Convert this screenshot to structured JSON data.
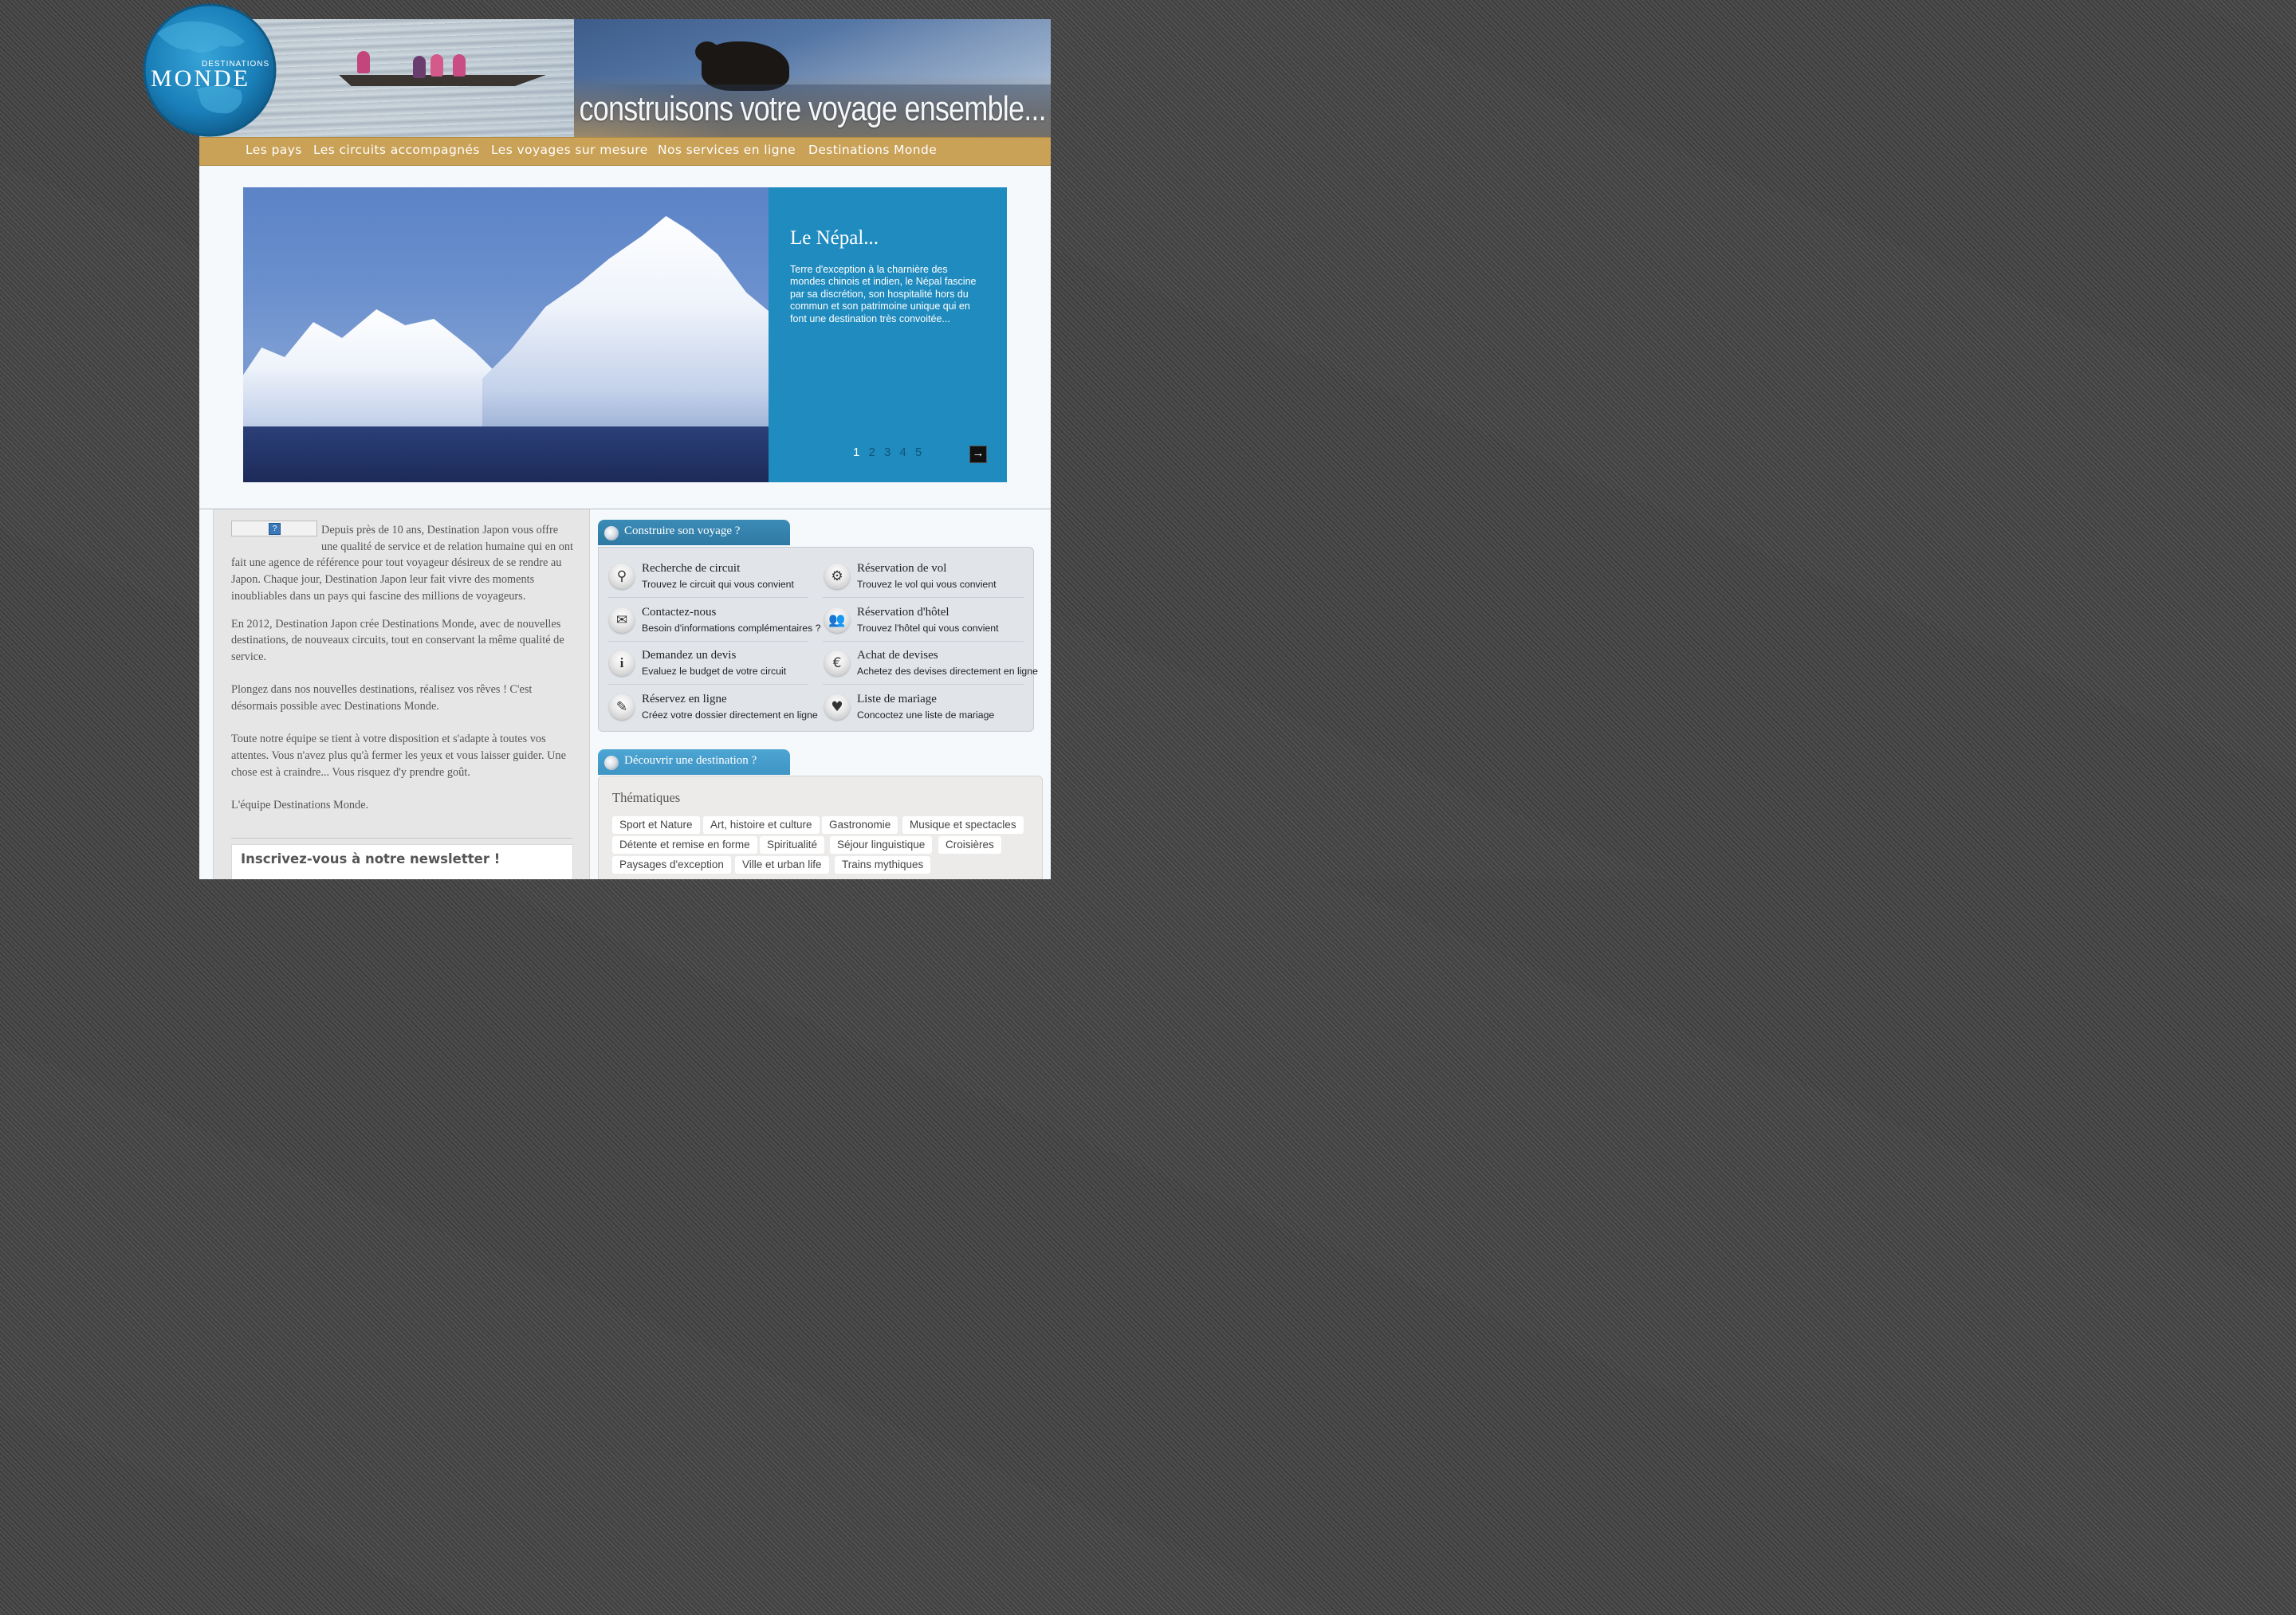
{
  "header": {
    "brand_small": "DESTINATIONS",
    "brand_big": "MONDE",
    "tagline": "construisons votre voyage ensemble..."
  },
  "nav": {
    "items": [
      "Les pays",
      "Les circuits accompagnés",
      "Les voyages sur mesure",
      "Nos services en ligne",
      "Destinations Monde"
    ]
  },
  "slider": {
    "title": "Le Népal...",
    "description": "Terre d'exception à la charnière des mondes chinois et indien, le Népal fascine par sa discrétion, son hospitalité hors du commun et son patrimoine unique qui en font une destination très convoitée...",
    "pages": [
      "1",
      "2",
      "3",
      "4",
      "5"
    ],
    "current_page": "1",
    "next_arrow": "→"
  },
  "intro": {
    "paragraphs": [
      "Depuis près de 10 ans, Destination Japon vous offre une qualité de service et de relation humaine qui en ont fait une agence de référence pour tout voyageur désireux de se rendre au Japon. Chaque jour, Destination Japon leur fait vivre des moments inoubliables dans un pays qui fascine des millions de voyageurs.",
      "En 2012, Destination Japon crée Destinations Monde, avec de nouvelles destinations, de nouveaux circuits, tout en conservant la même qualité de service.",
      "Plongez dans nos nouvelles destinations, réalisez vos rêves ! C'est désormais possible avec Destinations Monde.",
      "Toute notre équipe se tient à votre disposition et s'adapte à toutes vos attentes. Vous n'avez plus qu'à fermer les yeux et vous laisser guider. Une chose est à craindre... Vous risquez d'y prendre goût.",
      "L'équipe Destinations Monde."
    ],
    "broken_image_glyph": "?"
  },
  "newsletter": {
    "title": "Inscrivez-vous à notre newsletter !"
  },
  "construire": {
    "tab_label": "Construire son voyage ?",
    "services": [
      {
        "title": "Recherche de circuit",
        "subtitle": "Trouvez le circuit qui vous convient",
        "icon": "binoculars-icon",
        "glyph": "⚲"
      },
      {
        "title": "Réservation de vol",
        "subtitle": "Trouvez le vol qui vous convient",
        "icon": "gear-icon",
        "glyph": "⚙"
      },
      {
        "title": "Contactez-nous",
        "subtitle": "Besoin d'informations complémentaires ?",
        "icon": "envelope-icon",
        "glyph": "✉"
      },
      {
        "title": "Réservation d'hôtel",
        "subtitle": "Trouvez l'hôtel qui vous convient",
        "icon": "users-icon",
        "glyph": "👥"
      },
      {
        "title": "Demandez un devis",
        "subtitle": "Evaluez le budget de votre circuit",
        "icon": "info-icon",
        "glyph": "i"
      },
      {
        "title": "Achat de devises",
        "subtitle": "Achetez des devises directement en ligne",
        "icon": "euro-icon",
        "glyph": "€"
      },
      {
        "title": "Réservez en ligne",
        "subtitle": "Créez votre dossier directement en ligne",
        "icon": "pencil-icon",
        "glyph": "✎"
      },
      {
        "title": "Liste de mariage",
        "subtitle": "Concoctez une liste de mariage",
        "icon": "heart-icon",
        "glyph": "♥"
      }
    ]
  },
  "decouvrir": {
    "tab_label": "Découvrir une destination ?",
    "section_title": "Thématiques",
    "chips": [
      "Sport et Nature",
      "Art, histoire et culture",
      "Gastronomie",
      "Musique et spectacles",
      "Détente et remise en forme",
      "Spiritualité",
      "Séjour linguistique",
      "Croisières",
      "Paysages d'exception",
      "Ville et urban life",
      "Trains mythiques"
    ]
  },
  "colors": {
    "nav_bar": "#c9a157",
    "slide_panel": "#1f8bbf",
    "tab_construire": "#2f7aa4",
    "tab_decouvrir": "#3f95c4"
  }
}
